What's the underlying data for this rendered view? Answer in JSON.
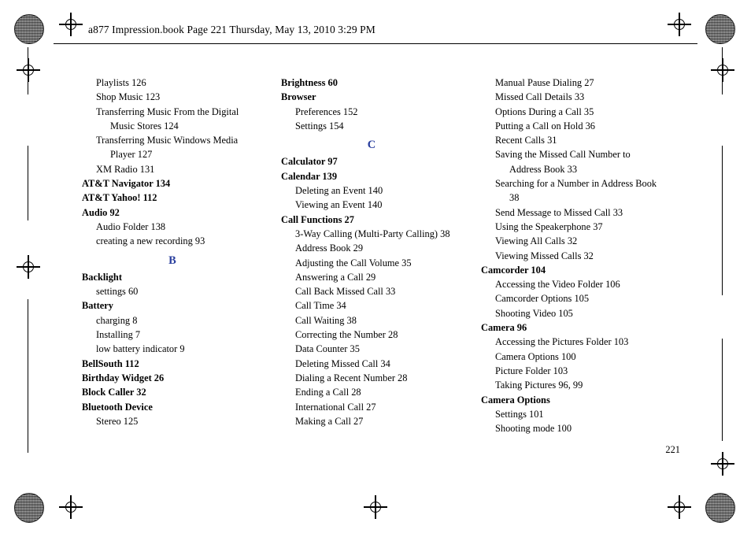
{
  "header": {
    "text": "a877 Impression.book  Page 221  Thursday, May 13, 2010  3:29 PM"
  },
  "page_number": "221",
  "accent_color": "#2a3f9e",
  "columns": [
    {
      "name": "column-1",
      "blocks": [
        {
          "type": "entry",
          "level": 1,
          "text": "Playlists  126"
        },
        {
          "type": "entry",
          "level": 1,
          "text": "Shop Music  123"
        },
        {
          "type": "entry",
          "level": 1,
          "wrap": true,
          "text": "Transferring Music From the Digital Music Stores  124"
        },
        {
          "type": "entry",
          "level": 1,
          "wrap": true,
          "text": "Transferring Music Windows Media Player  127"
        },
        {
          "type": "entry",
          "level": 1,
          "text": "XM Radio  131"
        },
        {
          "type": "entry",
          "level": 0,
          "text": "AT&T Navigator  134"
        },
        {
          "type": "entry",
          "level": 0,
          "text": "AT&T Yahoo!  112"
        },
        {
          "type": "entry",
          "level": 0,
          "text": "Audio  92"
        },
        {
          "type": "entry",
          "level": 1,
          "text": "Audio Folder  138"
        },
        {
          "type": "entry",
          "level": 1,
          "text": "creating a new recording  93"
        },
        {
          "type": "letter",
          "text": "B"
        },
        {
          "type": "entry",
          "level": 0,
          "text": "Backlight"
        },
        {
          "type": "entry",
          "level": 1,
          "text": "settings  60"
        },
        {
          "type": "entry",
          "level": 0,
          "text": "Battery"
        },
        {
          "type": "entry",
          "level": 1,
          "text": "charging  8"
        },
        {
          "type": "entry",
          "level": 1,
          "text": "Installing  7"
        },
        {
          "type": "entry",
          "level": 1,
          "text": "low battery indicator  9"
        },
        {
          "type": "entry",
          "level": 0,
          "text": "BellSouth  112"
        },
        {
          "type": "entry",
          "level": 0,
          "text": "Birthday Widget  26"
        },
        {
          "type": "entry",
          "level": 0,
          "text": "Block Caller  32"
        },
        {
          "type": "entry",
          "level": 0,
          "text": "Bluetooth Device"
        },
        {
          "type": "entry",
          "level": 1,
          "text": "Stereo  125"
        }
      ]
    },
    {
      "name": "column-2",
      "blocks": [
        {
          "type": "entry",
          "level": 0,
          "text": "Brightness  60"
        },
        {
          "type": "entry",
          "level": 0,
          "text": "Browser"
        },
        {
          "type": "entry",
          "level": 1,
          "text": "Preferences  152"
        },
        {
          "type": "entry",
          "level": 1,
          "text": "Settings  154"
        },
        {
          "type": "letter",
          "text": "C"
        },
        {
          "type": "entry",
          "level": 0,
          "text": "Calculator  97"
        },
        {
          "type": "entry",
          "level": 0,
          "text": "Calendar  139"
        },
        {
          "type": "entry",
          "level": 1,
          "text": "Deleting an Event  140"
        },
        {
          "type": "entry",
          "level": 1,
          "text": "Viewing an Event  140"
        },
        {
          "type": "entry",
          "level": 0,
          "text": "Call Functions  27"
        },
        {
          "type": "entry",
          "level": 1,
          "wrap": true,
          "text": "3-Way Calling (Multi-Party Calling)  38"
        },
        {
          "type": "entry",
          "level": 1,
          "text": "Address Book  29"
        },
        {
          "type": "entry",
          "level": 1,
          "text": "Adjusting the Call Volume  35"
        },
        {
          "type": "entry",
          "level": 1,
          "text": "Answering a Call  29"
        },
        {
          "type": "entry",
          "level": 1,
          "text": "Call Back Missed Call  33"
        },
        {
          "type": "entry",
          "level": 1,
          "text": "Call Time  34"
        },
        {
          "type": "entry",
          "level": 1,
          "text": "Call Waiting  38"
        },
        {
          "type": "entry",
          "level": 1,
          "text": "Correcting the Number  28"
        },
        {
          "type": "entry",
          "level": 1,
          "text": "Data Counter  35"
        },
        {
          "type": "entry",
          "level": 1,
          "text": "Deleting Missed Call  34"
        },
        {
          "type": "entry",
          "level": 1,
          "text": "Dialing a Recent Number  28"
        },
        {
          "type": "entry",
          "level": 1,
          "text": "Ending a Call  28"
        },
        {
          "type": "entry",
          "level": 1,
          "text": "International Call  27"
        },
        {
          "type": "entry",
          "level": 1,
          "text": "Making a Call  27"
        }
      ]
    },
    {
      "name": "column-3",
      "blocks": [
        {
          "type": "entry",
          "level": 1,
          "text": "Manual Pause Dialing  27"
        },
        {
          "type": "entry",
          "level": 1,
          "text": "Missed Call Details  33"
        },
        {
          "type": "entry",
          "level": 1,
          "text": "Options During a Call  35"
        },
        {
          "type": "entry",
          "level": 1,
          "text": "Putting a Call on Hold  36"
        },
        {
          "type": "entry",
          "level": 1,
          "text": "Recent Calls  31"
        },
        {
          "type": "entry",
          "level": 1,
          "wrap": true,
          "text": "Saving the Missed Call Number to Address Book  33"
        },
        {
          "type": "entry",
          "level": 1,
          "wrap": true,
          "text": "Searching for a Number in Address Book  38"
        },
        {
          "type": "entry",
          "level": 1,
          "text": "Send Message to Missed Call  33"
        },
        {
          "type": "entry",
          "level": 1,
          "text": "Using the Speakerphone  37"
        },
        {
          "type": "entry",
          "level": 1,
          "text": "Viewing All Calls  32"
        },
        {
          "type": "entry",
          "level": 1,
          "text": "Viewing Missed Calls  32"
        },
        {
          "type": "entry",
          "level": 0,
          "text": "Camcorder  104"
        },
        {
          "type": "entry",
          "level": 1,
          "text": "Accessing the Video Folder  106"
        },
        {
          "type": "entry",
          "level": 1,
          "text": "Camcorder Options  105"
        },
        {
          "type": "entry",
          "level": 1,
          "text": "Shooting Video  105"
        },
        {
          "type": "entry",
          "level": 0,
          "text": "Camera  96"
        },
        {
          "type": "entry",
          "level": 1,
          "text": "Accessing the Pictures Folder  103"
        },
        {
          "type": "entry",
          "level": 1,
          "text": "Camera Options  100"
        },
        {
          "type": "entry",
          "level": 1,
          "text": "Picture Folder  103"
        },
        {
          "type": "entry",
          "level": 1,
          "text": "Taking Pictures  96, 99"
        },
        {
          "type": "entry",
          "level": 0,
          "text": "Camera Options"
        },
        {
          "type": "entry",
          "level": 1,
          "text": "Settings  101"
        },
        {
          "type": "entry",
          "level": 1,
          "text": "Shooting mode  100"
        }
      ]
    }
  ]
}
